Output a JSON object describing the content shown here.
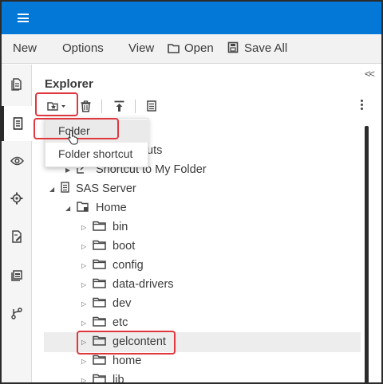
{
  "menubar": {
    "new_label": "New",
    "options_label": "Options",
    "view_label": "View",
    "open_label": "Open",
    "save_all_label": "Save All"
  },
  "rail": {
    "icons": [
      "document-icon",
      "server-icon",
      "eye-icon",
      "gear-icon",
      "file-edit-icon",
      "library-icon",
      "git-icon"
    ]
  },
  "explorer": {
    "title": "Explorer",
    "collapse_label": "<<",
    "toolbar_icons": [
      "new-dropdown-icon",
      "delete-icon",
      "upload-icon",
      "properties-icon",
      "more-icon"
    ]
  },
  "new_menu": {
    "items": [
      "Folder",
      "Folder shortcut"
    ]
  },
  "tree": {
    "partial_item_suffix": "uts",
    "shortcut": "Shortcut to My Folder",
    "server": "SAS Server",
    "home": "Home",
    "folders": [
      "bin",
      "boot",
      "config",
      "data-drivers",
      "dev",
      "etc",
      "gelcontent",
      "home",
      "lib"
    ]
  },
  "colors": {
    "topbar": "#0478d7",
    "highlight": "#e0383e",
    "selection": "#ededed"
  }
}
